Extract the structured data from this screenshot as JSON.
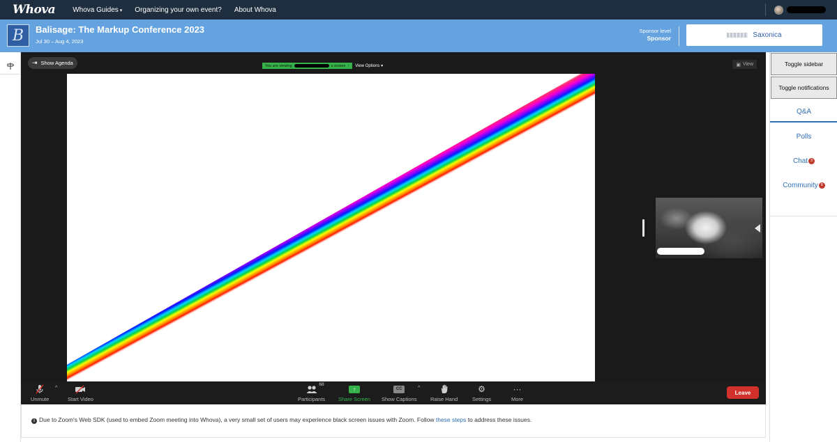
{
  "nav": {
    "logo": "Whova",
    "links": [
      "Whova Guides",
      "Organizing your own event?",
      "About Whova"
    ],
    "caret": "▾"
  },
  "event": {
    "logo_letter": "B",
    "title": "Balisage: The Markup Conference 2023",
    "dates": "Jul 30 – Aug 4, 2023",
    "sponsor_level_label": "Sponsor level",
    "sponsor_level": "Sponsor",
    "sponsor_name": "Saxonica"
  },
  "zoom": {
    "show_agenda": "Show Agenda",
    "viewing_prefix": "You are viewing",
    "viewing_suffix": "s screen",
    "view_options": "View Options",
    "view": "View",
    "participants_count": "68",
    "controls": {
      "unmute": "Unmute",
      "start_video": "Start Video",
      "participants": "Participants",
      "share_screen": "Share Screen",
      "show_captions": "Show Captions",
      "cc": "CC",
      "raise_hand": "Raise Hand",
      "settings": "Settings",
      "more": "More",
      "leave": "Leave"
    },
    "share_color": "#35b34a",
    "leave_color": "#d1312a"
  },
  "notice": {
    "before": "Due to Zoom's Web SDK (used to embed Zoom meeting into Whova), a very small set of users may experience black screen issues with Zoom. Follow ",
    "link": "these steps",
    "after": " to address these issues."
  },
  "sidebar": {
    "toggle_sidebar": "Toggle sidebar",
    "toggle_notifications": "Toggle notifications",
    "tabs": {
      "qa": "Q&A",
      "polls": "Polls",
      "chat": "Chat",
      "chat_badge": "3",
      "community": "Community",
      "community_badge": "8"
    }
  },
  "accent_color": "#2f6fb4",
  "header_color": "#64a3e0",
  "topnav_color": "#1e2e3e"
}
